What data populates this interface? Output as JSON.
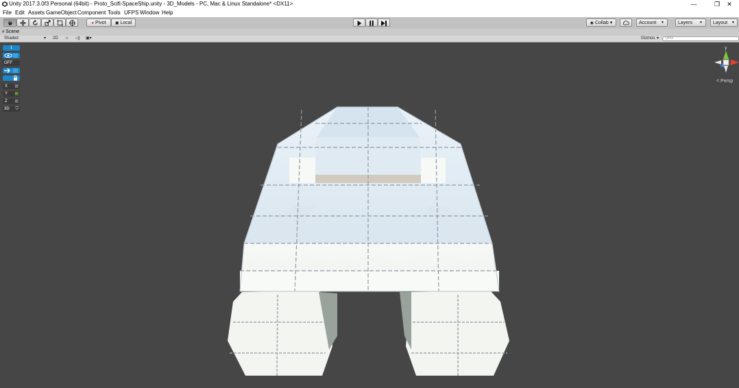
{
  "window": {
    "title": "Unity 2017.3.0f3 Personal (64bit) - Proto_Scifi-SpaceShip.unity - 3D_Models - PC, Mac & Linux Standalone* <DX11>",
    "minimize": "—",
    "restore": "❐",
    "close": "✕"
  },
  "menu": [
    "File",
    "Edit",
    "Assets",
    "GameObject",
    "Component",
    "Tools",
    "UFPS",
    "Window",
    "Help"
  ],
  "toolbar": {
    "pivot_label": "Pivot",
    "local_label": "Local",
    "collab_label": "Collab ▾",
    "account_label": "Account",
    "layers_label": "Layers",
    "layout_label": "Layout"
  },
  "scene_tab": {
    "label": "Scene"
  },
  "scene_bar": {
    "shading_mode": "Shaded",
    "mode_2d": "2D",
    "gizmos_label": "Gizmos",
    "search_placeholder": "Q▾All"
  },
  "scene_gizmos": [
    {
      "label": "1",
      "color": "#1b86c8"
    },
    {
      "label": "",
      "color": "#1b86c8"
    },
    {
      "label": "OFF",
      "color": "#3a3a3a"
    },
    {
      "label": "",
      "color": "#1b86c8"
    },
    {
      "label": "",
      "color": "#1b86c8"
    },
    {
      "label": "X",
      "color": "#3a3a3a"
    },
    {
      "label": "Y",
      "color": "#3a3a3a"
    },
    {
      "label": "Z",
      "color": "#3a3a3a"
    },
    {
      "label": "3D",
      "color": "#3a3a3a"
    }
  ],
  "view_gizmo": {
    "projection_label": "< Persp",
    "axis_y": "y",
    "axis_x_color": "#e8412c",
    "axis_y_color": "#7ec832",
    "axis_z_color": "#3a7cd8"
  },
  "colors": {
    "viewport_bg": "#464646",
    "toolbar_bg": "#c2c2c2",
    "accent_blue": "#1b86c8",
    "mesh_face": "#eef4f8",
    "mesh_shade": "#cfdde8"
  }
}
